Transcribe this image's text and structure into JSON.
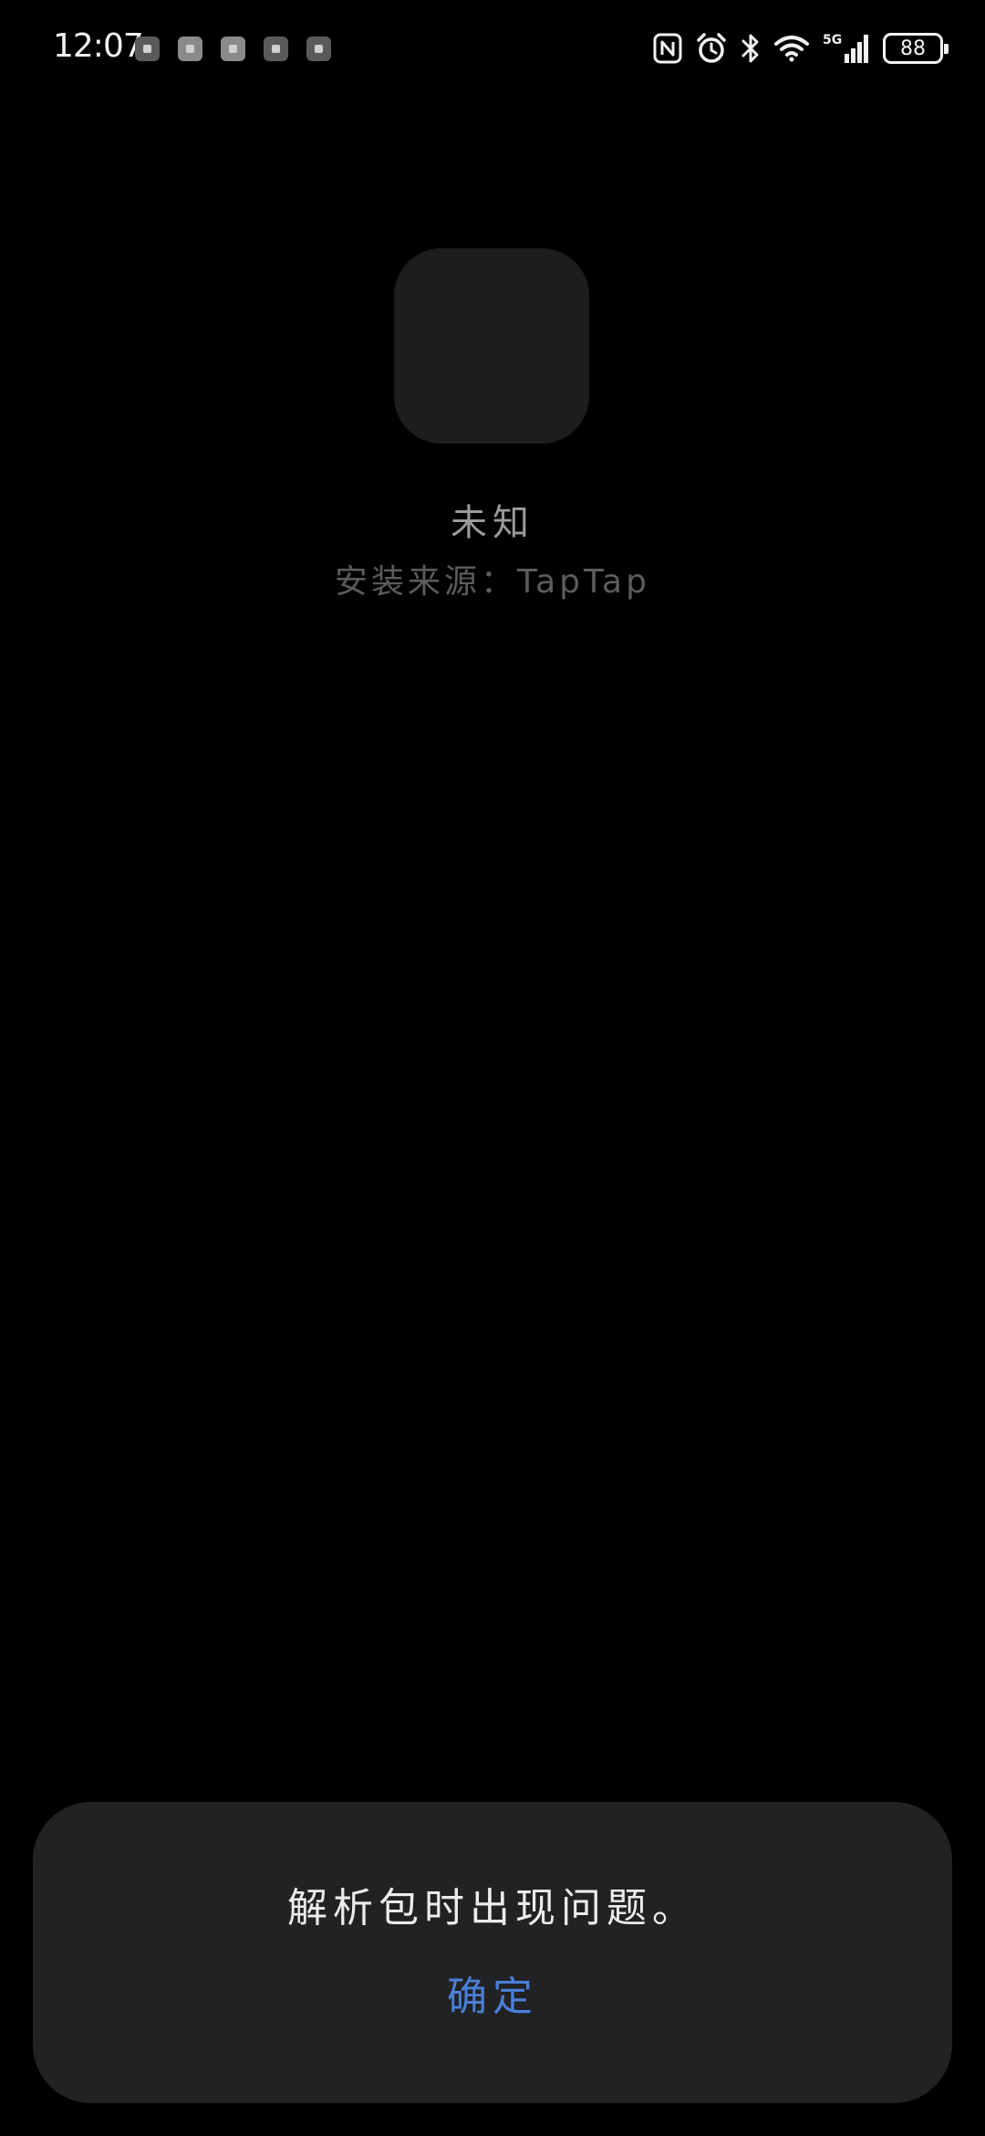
{
  "status_bar": {
    "time": "12:07",
    "notification_icons": [
      "notification-icon",
      "notification-icon",
      "notification-icon",
      "notification-icon",
      "notification-icon"
    ],
    "network": "5G",
    "battery_level": "88"
  },
  "app": {
    "name": "未知",
    "install_source": "安装来源：TapTap"
  },
  "dialog": {
    "message": "解析包时出现问题。",
    "confirm_label": "确定"
  },
  "colors": {
    "background": "#000000",
    "dialog_background": "#212224",
    "accent": "#4a7fd6"
  }
}
